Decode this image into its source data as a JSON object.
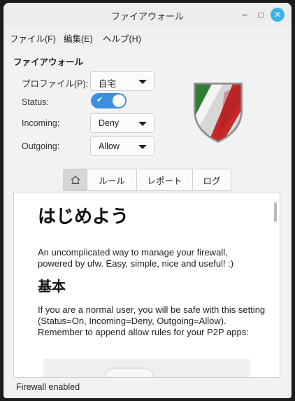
{
  "window": {
    "title": "ファイアウォール"
  },
  "titlebar_buttons": {
    "minimize": "−",
    "maximize": "□",
    "close": "✕"
  },
  "menu": [
    {
      "label": "ファイル(F)"
    },
    {
      "label": "編集(E)"
    },
    {
      "label": "ヘルプ(H)"
    }
  ],
  "firewall": {
    "section_title": "ファイアウォール",
    "profile_label": "プロファイル(P):",
    "profile_value": "自宅",
    "status_label": "Status:",
    "status_on": true,
    "incoming_label": "Incoming:",
    "incoming_value": "Deny",
    "outgoing_label": "Outgoing:",
    "outgoing_value": "Allow"
  },
  "tabs": [
    {
      "icon": "home-icon",
      "label": ""
    },
    {
      "label": "ルール"
    },
    {
      "label": "レポート"
    },
    {
      "label": "ログ"
    }
  ],
  "doc": {
    "heading": "はじめよう",
    "intro": "An uncomplicated way to manage your firewall, powered by ufw. Easy, simple, nice and useful! :)",
    "basic_heading": "基本",
    "basic_text": "If you are a normal user, you will be safe with this setting (Status=On, Incoming=Deny, Outgoing=Allow). Remember to append allow rules for your P2P apps:"
  },
  "status_bar": {
    "text": "Firewall enabled"
  },
  "colors": {
    "accent": "#3c8fe0",
    "close_button": "#3cb1e6",
    "shield_green": "#2e7d32",
    "shield_red": "#c62828"
  }
}
